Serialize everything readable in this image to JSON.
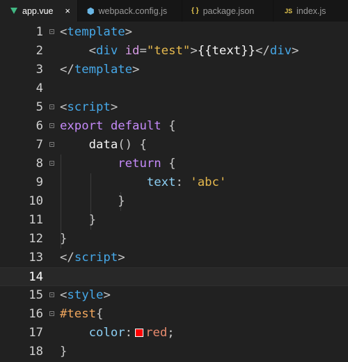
{
  "tabs": [
    {
      "label": "app.vue",
      "icon": "vue-icon",
      "close": "×",
      "active": true
    },
    {
      "label": "webpack.config.js",
      "icon": "webpack-icon",
      "glyph": "⬢"
    },
    {
      "label": "package.json",
      "icon": "json-icon",
      "glyph": "{ }"
    },
    {
      "label": "index.js",
      "icon": "js-icon",
      "glyph": "JS"
    }
  ],
  "editor": {
    "line_numbers": [
      "1",
      "2",
      "3",
      "4",
      "5",
      "6",
      "7",
      "8",
      "9",
      "10",
      "11",
      "12",
      "13",
      "14",
      "15",
      "16",
      "17",
      "18"
    ],
    "current_line": 14,
    "lines": {
      "l1": {
        "open": "<",
        "tag": "template",
        "close": ">"
      },
      "l2": {
        "open": "<",
        "tag": "div",
        "attr": "id",
        "eq": "=",
        "value": "\"test\"",
        "close": ">",
        "text": "{{text}}",
        "end_open": "</",
        "end_tag": "div",
        "end_close": ">"
      },
      "l3": {
        "open": "</",
        "tag": "template",
        "close": ">"
      },
      "l5": {
        "open": "<",
        "tag": "script",
        "close": ">"
      },
      "l6": {
        "kw1": "export",
        "kw2": "default",
        "brace": "{"
      },
      "l7": {
        "fn": "data",
        "rest": "() {"
      },
      "l8": {
        "kw": "return",
        "brace": "{"
      },
      "l9": {
        "prop": "text",
        "colon": ":",
        "value": "'abc'"
      },
      "l10": {
        "brace": "}"
      },
      "l11": {
        "brace": "}"
      },
      "l12": {
        "brace": "}"
      },
      "l13": {
        "open": "</",
        "tag": "script",
        "close": ">"
      },
      "l15": {
        "open": "<",
        "tag": "style",
        "close": ">"
      },
      "l16": {
        "selector": "#test",
        "brace": "{"
      },
      "l17": {
        "prop": "color",
        "colon": ":",
        "value": "red",
        "semi": ";"
      },
      "l18": {
        "brace": "}"
      }
    },
    "swatch_color": "#ff0000"
  }
}
